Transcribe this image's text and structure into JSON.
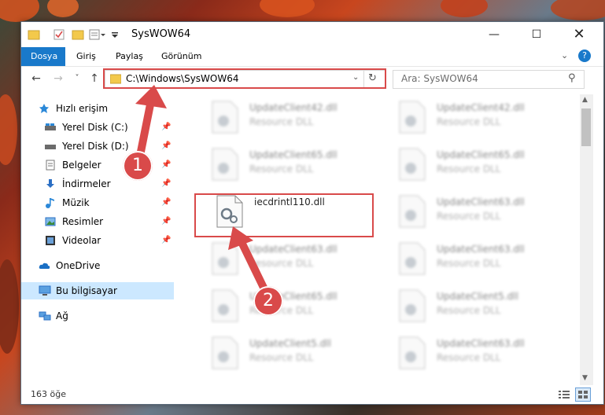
{
  "window": {
    "title": "SysWOW64"
  },
  "ribbon": {
    "tabs": [
      "Dosya",
      "Giriş",
      "Paylaş",
      "Görünüm"
    ]
  },
  "address": {
    "path": "C:\\Windows\\SysWOW64"
  },
  "search": {
    "placeholder": "Ara: SysWOW64"
  },
  "sidebar": {
    "quick_access": "Hızlı erişim",
    "items": [
      "Yerel Disk (C:)",
      "Yerel Disk (D:)",
      "Belgeler",
      "İndirmeler",
      "Müzik",
      "Resimler",
      "Videolar"
    ],
    "onedrive": "OneDrive",
    "this_pc": "Bu bilgisayar",
    "network": "Ağ"
  },
  "files": [
    {
      "name": "UpdateClient42.dll",
      "type": "Resource DLL"
    },
    {
      "name": "UpdateClient42.dll",
      "type": "Resource DLL"
    },
    {
      "name": "UpdateClient65.dll",
      "type": "Resource DLL"
    },
    {
      "name": "UpdateClient65.dll",
      "type": "Resource DLL"
    },
    {
      "name": "iecdrintl110.dll",
      "type": ""
    },
    {
      "name": "UpdateClient63.dll",
      "type": "Resource DLL"
    },
    {
      "name": "UpdateClient63.dll",
      "type": "Resource DLL"
    },
    {
      "name": "UpdateClient63.dll",
      "type": "Resource DLL"
    },
    {
      "name": "UpdateClient65.dll",
      "type": "Resource DLL"
    },
    {
      "name": "UpdateClient5.dll",
      "type": "Resource DLL"
    },
    {
      "name": "UpdateClient5.dll",
      "type": "Resource DLL"
    },
    {
      "name": "UpdateClient63.dll",
      "type": "Resource DLL"
    }
  ],
  "status": {
    "count": "163 öğe"
  },
  "annotations": {
    "badge1": "1",
    "badge2": "2"
  },
  "colors": {
    "accent": "#1979ca",
    "highlight": "#d94a4a",
    "selected": "#cce8ff"
  }
}
